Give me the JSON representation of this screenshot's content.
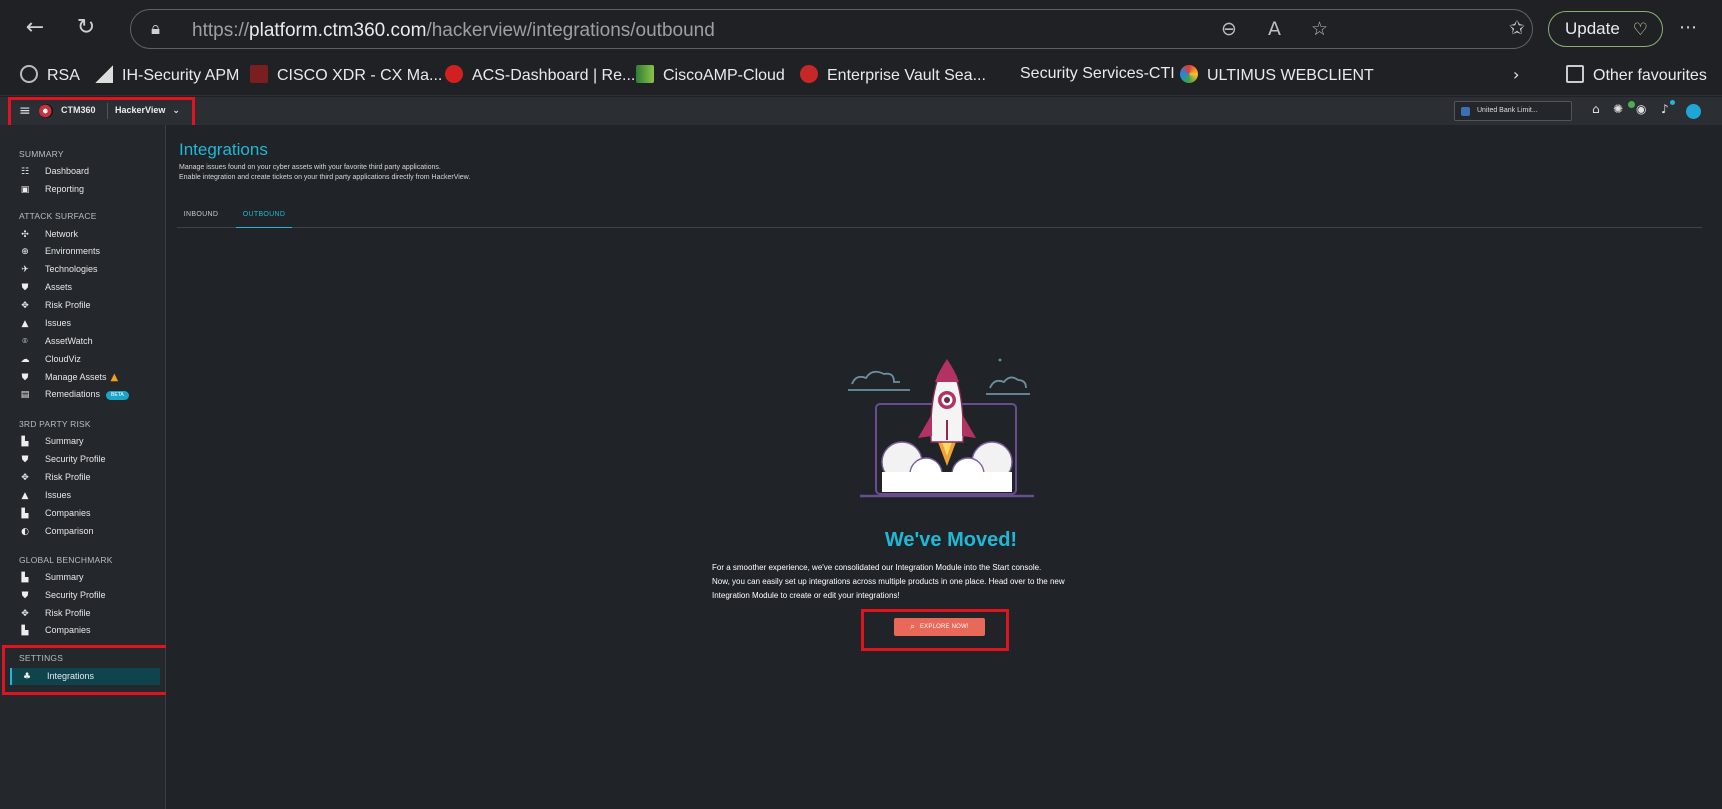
{
  "browser": {
    "url_prefix": "https://",
    "url_host": "platform.ctm360.com",
    "url_path": "/hackerview/integrations/outbound",
    "update_label": "Update",
    "bookmarks": [
      {
        "label": "RSA",
        "color": "#6b7c8f"
      },
      {
        "label": "IH-Security APM",
        "color": "#222222"
      },
      {
        "label": "CISCO XDR - CX Ma...",
        "color": "#c0392b"
      },
      {
        "label": "ACS-Dashboard | Re...",
        "color": "#d02020"
      },
      {
        "label": "CiscoAMP-Cloud",
        "color": "#4caf50"
      },
      {
        "label": "Enterprise Vault Sea...",
        "color": "#c62828"
      },
      {
        "label": "Security Services-CTI",
        "color": ""
      },
      {
        "label": "ULTIMUS WEBCLIENT",
        "color": "#e57373"
      }
    ],
    "other_favourites": "Other favourites"
  },
  "app": {
    "brand": "CTM360",
    "product": "HackerView",
    "org": "United Bank Limit..."
  },
  "sidebar": {
    "sections": [
      {
        "title": "SUMMARY",
        "items": [
          {
            "label": "Dashboard",
            "icon": "☷"
          },
          {
            "label": "Reporting",
            "icon": "▣"
          }
        ]
      },
      {
        "title": "ATTACK SURFACE",
        "items": [
          {
            "label": "Network",
            "icon": "✣"
          },
          {
            "label": "Environments",
            "icon": "⊕"
          },
          {
            "label": "Technologies",
            "icon": "✈"
          },
          {
            "label": "Assets",
            "icon": "⛊"
          },
          {
            "label": "Risk Profile",
            "icon": "✥"
          },
          {
            "label": "Issues",
            "icon": "▲"
          },
          {
            "label": "AssetWatch",
            "icon": "⌾"
          },
          {
            "label": "CloudViz",
            "icon": "☁"
          },
          {
            "label": "Manage Assets",
            "icon": "⛊"
          },
          {
            "label": "Remediations",
            "icon": "▤",
            "badge": "BETA"
          }
        ]
      },
      {
        "title": "3RD PARTY RISK",
        "items": [
          {
            "label": "Summary",
            "icon": "▙"
          },
          {
            "label": "Security Profile",
            "icon": "⛊"
          },
          {
            "label": "Risk Profile",
            "icon": "✥"
          },
          {
            "label": "Issues",
            "icon": "▲"
          },
          {
            "label": "Companies",
            "icon": "▙"
          },
          {
            "label": "Comparison",
            "icon": "◐"
          }
        ]
      },
      {
        "title": "GLOBAL BENCHMARK",
        "items": [
          {
            "label": "Summary",
            "icon": "▙"
          },
          {
            "label": "Security Profile",
            "icon": "⛊"
          },
          {
            "label": "Risk Profile",
            "icon": "✥"
          },
          {
            "label": "Companies",
            "icon": "▙"
          }
        ]
      },
      {
        "title": "SETTINGS",
        "items": [
          {
            "label": "Integrations",
            "icon": "♣"
          }
        ]
      }
    ]
  },
  "page": {
    "title": "Integrations",
    "desc_line1": "Manage issues found on your cyber assets with your favorite third party applications.",
    "desc_line2": "Enable integration and create tickets on your third party applications directly from HackerView.",
    "tabs": [
      "INBOUND",
      "OUTBOUND"
    ],
    "active_tab": "OUTBOUND",
    "moved_title": "We've Moved!",
    "moved_line1": "For a smoother experience, we've consolidated our Integration Module into the Start console.",
    "moved_line2": "Now, you can easily set up integrations across multiple products in one place. Head over to the new",
    "moved_line3": "Integration Module to create or edit your integrations!",
    "explore_label": "EXPLORE NOW!"
  },
  "colors": {
    "accent": "#1fb8d6",
    "highlight": "#e0141e",
    "button": "#e8685a"
  }
}
